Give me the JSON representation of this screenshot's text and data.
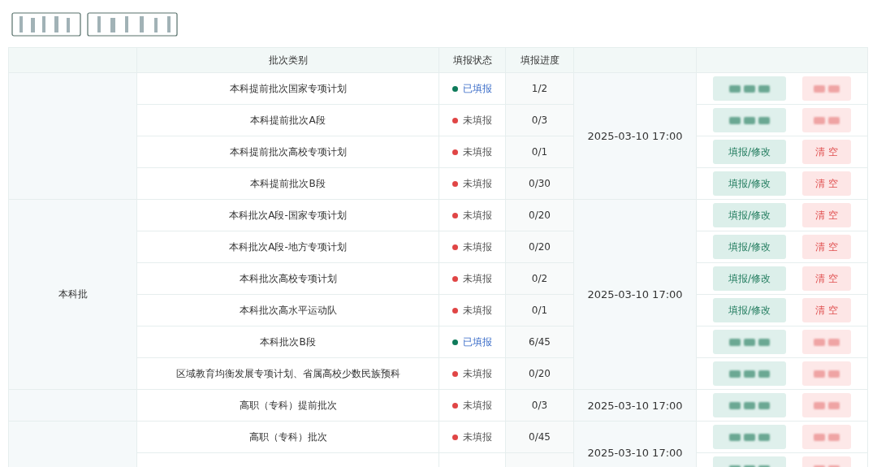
{
  "table": {
    "columns": [
      "批次类别",
      "填报状态",
      "填报进度"
    ],
    "groups": [
      {
        "deadline": "2025-03-10 17:00",
        "rows": [
          {
            "category": "本科提前批次国家专项计划",
            "status": "已填报",
            "done": true,
            "progress": "1/2",
            "redacted": true
          },
          {
            "category": "本科提前批次A段",
            "status": "未填报",
            "done": false,
            "progress": "0/3",
            "redacted": true
          },
          {
            "category": "本科提前批次高校专项计划",
            "status": "未填报",
            "done": false,
            "progress": "0/1",
            "redacted": false,
            "edit": "填报/修改",
            "clear": "清 空"
          },
          {
            "category": "本科提前批次B段",
            "status": "未填报",
            "done": false,
            "progress": "0/30",
            "redacted": false,
            "edit": "填报/修改",
            "clear": "清 空"
          }
        ]
      },
      {
        "label": "本科批",
        "deadline": "2025-03-10 17:00",
        "rows": [
          {
            "category": "本科批次A段-国家专项计划",
            "status": "未填报",
            "done": false,
            "progress": "0/20",
            "redacted": false,
            "edit": "填报/修改",
            "clear": "清 空"
          },
          {
            "category": "本科批次A段-地方专项计划",
            "status": "未填报",
            "done": false,
            "progress": "0/20",
            "redacted": false,
            "edit": "填报/修改",
            "clear": "清 空"
          },
          {
            "category": "本科批次高校专项计划",
            "status": "未填报",
            "done": false,
            "progress": "0/2",
            "redacted": false,
            "edit": "填报/修改",
            "clear": "清 空"
          },
          {
            "category": "本科批次高水平运动队",
            "status": "未填报",
            "done": false,
            "progress": "0/1",
            "redacted": false,
            "edit": "填报/修改",
            "clear": "清 空"
          },
          {
            "category": "本科批次B段",
            "status": "已填报",
            "done": true,
            "progress": "6/45",
            "redacted": true
          },
          {
            "category": "区域教育均衡发展专项计划、省属高校少数民族预科",
            "status": "未填报",
            "done": false,
            "progress": "0/20",
            "redacted": true
          }
        ]
      },
      {
        "deadline": "2025-03-10 17:00",
        "rows": [
          {
            "category": "高职（专科）提前批次",
            "status": "未填报",
            "done": false,
            "progress": "0/3",
            "redacted": true
          }
        ]
      },
      {
        "deadline": "2025-03-10 17:00",
        "rows": [
          {
            "category": "高职（专科）批次",
            "status": "未填报",
            "done": false,
            "progress": "0/45",
            "redacted": true
          },
          {
            "redacted": true
          }
        ]
      }
    ]
  }
}
